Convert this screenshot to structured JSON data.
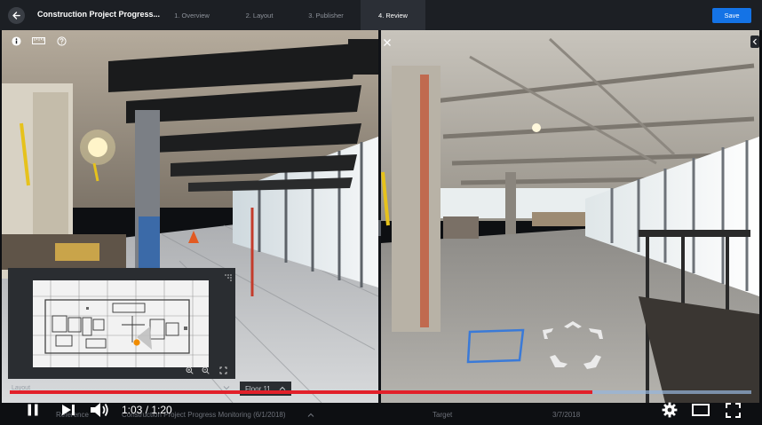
{
  "header": {
    "title": "Construction Project Progress...",
    "steps": [
      {
        "label": "1. Overview"
      },
      {
        "label": "2. Layout"
      },
      {
        "label": "3. Publisher"
      },
      {
        "label": "4. Review"
      }
    ],
    "save_label": "Save"
  },
  "minimap": {
    "layout_label": "Layout",
    "floor_label": "Floor 11"
  },
  "bottom": {
    "reference_label": "Reference",
    "reference_value": "Construction Project Progress Monitoring (6/1/2018)",
    "target_label": "Target",
    "target_date": "3/7/2018"
  },
  "player": {
    "time": "1:03 / 1:20",
    "progress": 0.786,
    "buffered": 1.0
  },
  "icons": [
    "back-arrow-icon",
    "info-icon",
    "ruler-icon",
    "help-icon",
    "close-icon",
    "chevron-left-icon",
    "play-pause-icon",
    "skip-next-icon",
    "volume-icon",
    "gear-icon",
    "theater-mode-icon",
    "fullscreen-icon",
    "zoom-in-icon",
    "zoom-out-icon",
    "expand-icon",
    "chevron-down-icon",
    "chevron-up-icon",
    "nav-arrows-icon"
  ],
  "colors": {
    "accent": "#1473e6",
    "progress": "#e2202a",
    "topbar": "#1c1f24",
    "marker": "#f08c00"
  }
}
